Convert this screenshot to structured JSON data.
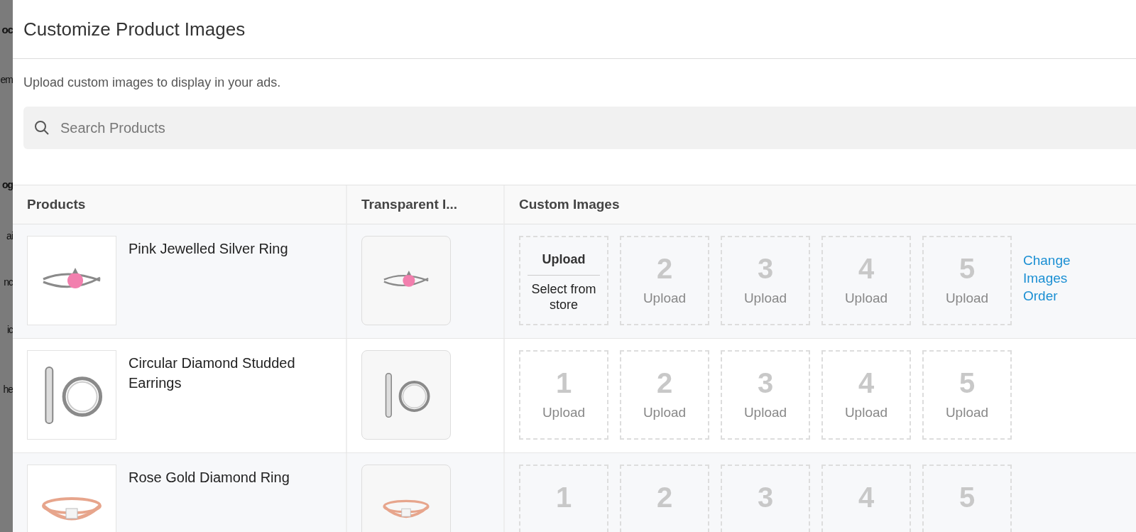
{
  "background_page": {
    "fragments": [
      "oc",
      "em",
      "og",
      "ai",
      "nc",
      "ic",
      "he"
    ]
  },
  "dialog": {
    "title": "Customize Product Images",
    "description": "Upload custom images to display in your ads.",
    "search": {
      "placeholder": "Search Products"
    }
  },
  "table": {
    "columns": [
      "Products",
      "Transparent I...",
      "Custom Images"
    ],
    "rows": [
      {
        "product": "Pink Jewelled Silver Ring",
        "kind": "pink_ring",
        "slots": [
          {
            "kind": "menu",
            "title": "Upload",
            "option": "Select from store"
          },
          {
            "kind": "empty",
            "number": "2",
            "label": "Upload"
          },
          {
            "kind": "empty",
            "number": "3",
            "label": "Upload"
          },
          {
            "kind": "empty",
            "number": "4",
            "label": "Upload"
          },
          {
            "kind": "empty",
            "number": "5",
            "label": "Upload"
          }
        ],
        "link": "Change Images Order"
      },
      {
        "product": "Circular Diamond Studded Earrings",
        "kind": "hoop_earrings",
        "slots": [
          {
            "kind": "empty",
            "number": "1",
            "label": "Upload"
          },
          {
            "kind": "empty",
            "number": "2",
            "label": "Upload"
          },
          {
            "kind": "empty",
            "number": "3",
            "label": "Upload"
          },
          {
            "kind": "empty",
            "number": "4",
            "label": "Upload"
          },
          {
            "kind": "empty",
            "number": "5",
            "label": "Upload"
          }
        ]
      },
      {
        "product": "Rose Gold Diamond Ring",
        "kind": "rose_ring",
        "slots": [
          {
            "kind": "empty",
            "number": "1"
          },
          {
            "kind": "empty",
            "number": "2"
          },
          {
            "kind": "empty",
            "number": "3"
          },
          {
            "kind": "empty",
            "number": "4"
          },
          {
            "kind": "empty",
            "number": "5"
          }
        ]
      }
    ]
  }
}
